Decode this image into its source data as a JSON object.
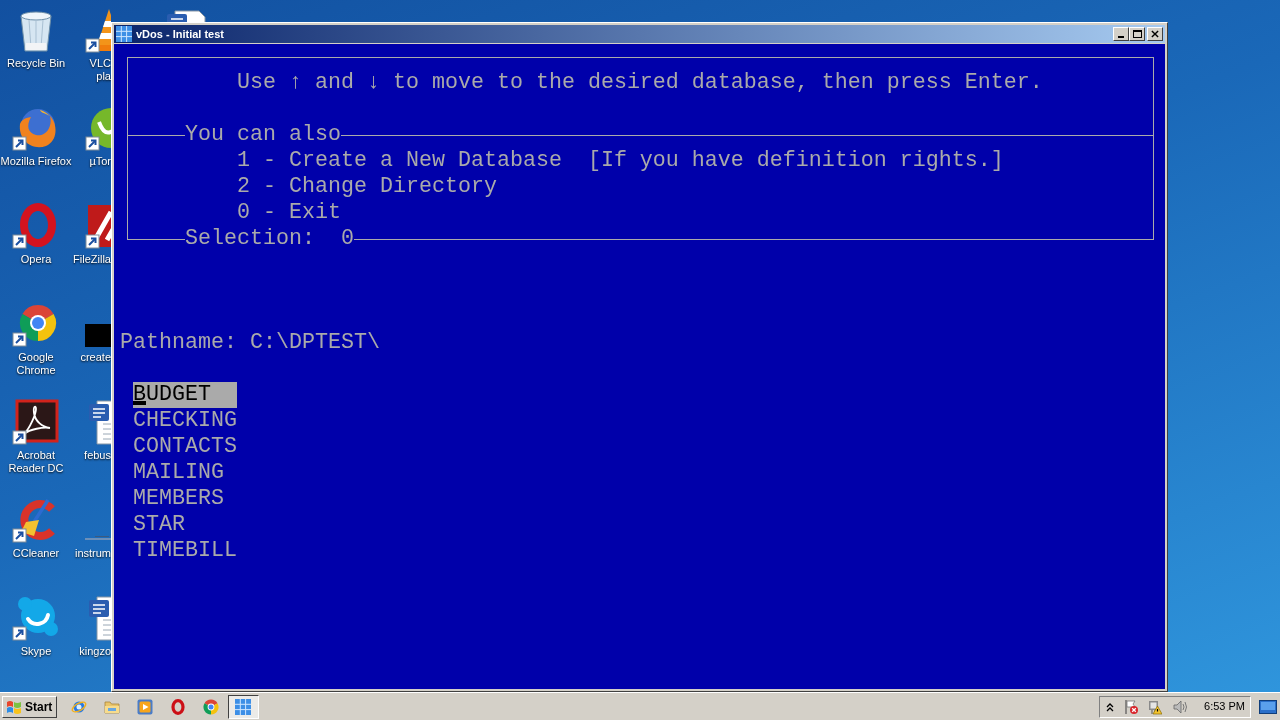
{
  "desktop": {
    "icon_columns": [
      {
        "icons": [
          {
            "kind": "trash",
            "label": "Recycle Bin",
            "shortcut": false
          },
          {
            "kind": "foxglobe",
            "label": "Mozilla Firefox",
            "shortcut": true
          },
          {
            "kind": "ring",
            "label": "Opera",
            "shortcut": true
          },
          {
            "kind": "wheel",
            "label": "Google Chrome",
            "shortcut": true
          },
          {
            "kind": "swirl",
            "label": "Acrobat Reader DC",
            "shortcut": true
          },
          {
            "kind": "broom",
            "label": "CCleaner",
            "shortcut": true
          },
          {
            "kind": "cloud",
            "label": "Skype",
            "shortcut": true
          }
        ]
      },
      {
        "icons": [
          {
            "kind": "cone",
            "label": "VLC\npla",
            "shortcut": true
          },
          {
            "kind": "disc",
            "label": "µTor",
            "shortcut": true
          },
          {
            "kind": "tile",
            "label": "FileZilla",
            "shortcut": true
          },
          {
            "kind": "square",
            "label": "create",
            "shortcut": false
          },
          {
            "kind": "document",
            "label": "febus",
            "shortcut": false
          },
          {
            "kind": "dash",
            "label": "instrum",
            "shortcut": false
          },
          {
            "kind": "document",
            "label": "kingzo",
            "shortcut": false
          }
        ]
      },
      {
        "icons": [
          {
            "kind": "document"
          }
        ]
      }
    ]
  },
  "window": {
    "title": "vDos - Initial test"
  },
  "dos_screen": {
    "instruction": "Use ↑ and ↓ to move to the desired database, then press Enter.",
    "options_heading": "You can also",
    "options": [
      "1 - Create a New Database  [If you have definition rights.]",
      "2 - Change Directory",
      "0 - Exit"
    ],
    "selection_label": "Selection:",
    "selection_value": "0",
    "pathname": "Pathname: C:\\DPTEST\\",
    "databases": [
      {
        "name": "BUDGET",
        "selected": true
      },
      {
        "name": "CHECKING",
        "selected": false
      },
      {
        "name": "CONTACTS",
        "selected": false
      },
      {
        "name": "MAILING",
        "selected": false
      },
      {
        "name": "MEMBERS",
        "selected": false
      },
      {
        "name": "STAR",
        "selected": false
      },
      {
        "name": "TIMEBILL",
        "selected": false
      }
    ]
  },
  "taskbar": {
    "start": "Start",
    "quick_launch": [
      {
        "kind": "globe"
      },
      {
        "kind": "folder"
      },
      {
        "kind": "play"
      },
      {
        "kind": "ring"
      },
      {
        "kind": "wheel"
      }
    ],
    "tasks": [
      {
        "kind": "grid",
        "selected": true
      }
    ],
    "tray": {
      "icons": [
        {
          "kind": "chevron"
        },
        {
          "kind": "flag"
        },
        {
          "kind": "network"
        },
        {
          "kind": "speaker"
        }
      ],
      "clock": "6:53 PM"
    }
  }
}
